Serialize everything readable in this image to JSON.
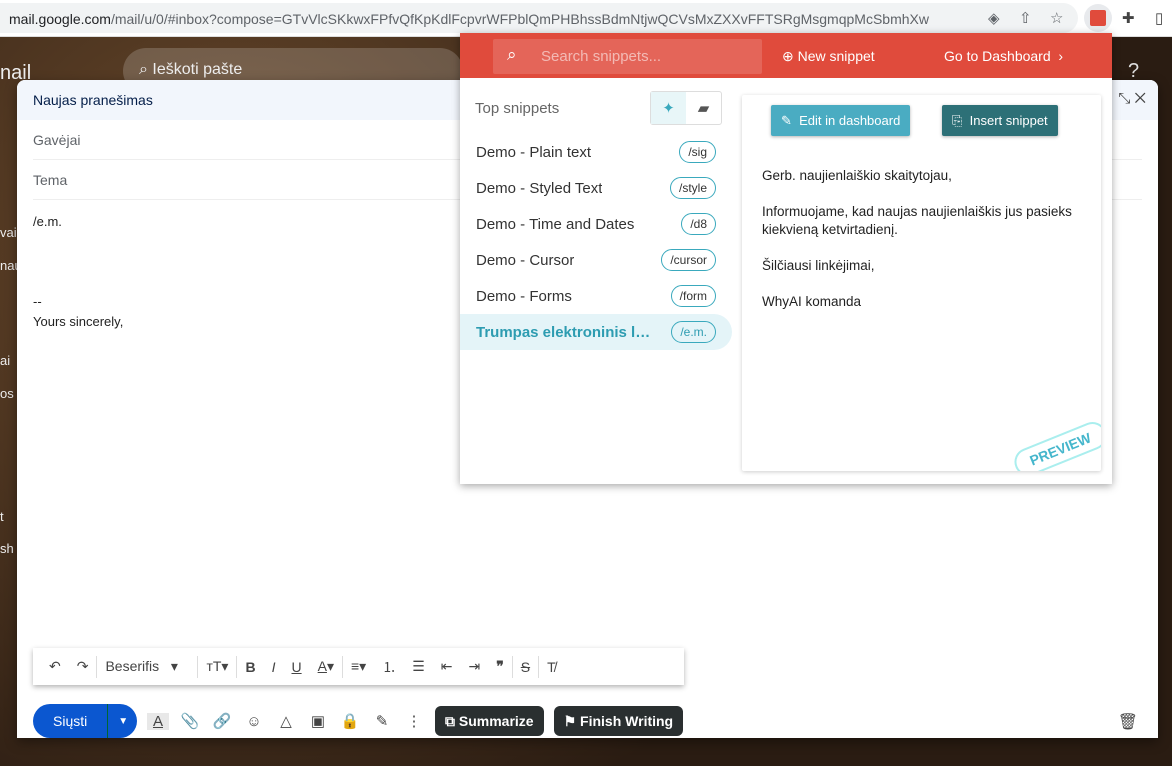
{
  "browser": {
    "url_host": "mail.google.com",
    "url_path": "/mail/u/0/#inbox?compose=GTvVlcSKkwxFPfvQfKpKdlFcpvrWFPblQmPHBhssBdmNtjwQCVsMxZXXvFFTSRgMsgmqpMcSbmhXw"
  },
  "gmail": {
    "logo_fragment": "nail",
    "search_placeholder": "Ieškoti pašte",
    "left_fragments": [
      "vai",
      "nau",
      "ai",
      "os",
      "t",
      "sh"
    ]
  },
  "compose": {
    "title": "Naujas pranešimas",
    "to_label": "Gavėjai",
    "subject_label": "Tema",
    "body": [
      "/e.m.",
      "",
      "",
      "--",
      "Yours sincerely,"
    ],
    "font": "Beserifis",
    "send_label": "Siųsti",
    "summarize_label": "Summarize",
    "finish_label": "Finish Writing"
  },
  "popup": {
    "search_placeholder": "Search snippets...",
    "new_snippet": "New snippet",
    "dashboard": "Go to Dashboard",
    "list_title": "Top snippets",
    "items": [
      {
        "name": "Demo - Plain text",
        "tag": "/sig"
      },
      {
        "name": "Demo - Styled Text",
        "tag": "/style"
      },
      {
        "name": "Demo - Time and Dates",
        "tag": "/d8"
      },
      {
        "name": "Demo - Cursor",
        "tag": "/cursor"
      },
      {
        "name": "Demo - Forms",
        "tag": "/form"
      },
      {
        "name": "Trumpas elektroninis laiškas",
        "tag": "/e.m."
      }
    ],
    "edit_label": "Edit in dashboard",
    "insert_label": "Insert snippet",
    "preview": [
      "Gerb. naujienlaiškio skaitytojau,",
      "Informuojame, kad naujas naujienlaiškis jus pasieks kiekvieną ketvirtadienį.",
      "Šilčiausi linkėjimai,",
      "WhyAI komanda"
    ],
    "stamp": "PREVIEW"
  },
  "colors": {
    "accent": "#e04b3c",
    "teal": "#3aa9bd"
  }
}
